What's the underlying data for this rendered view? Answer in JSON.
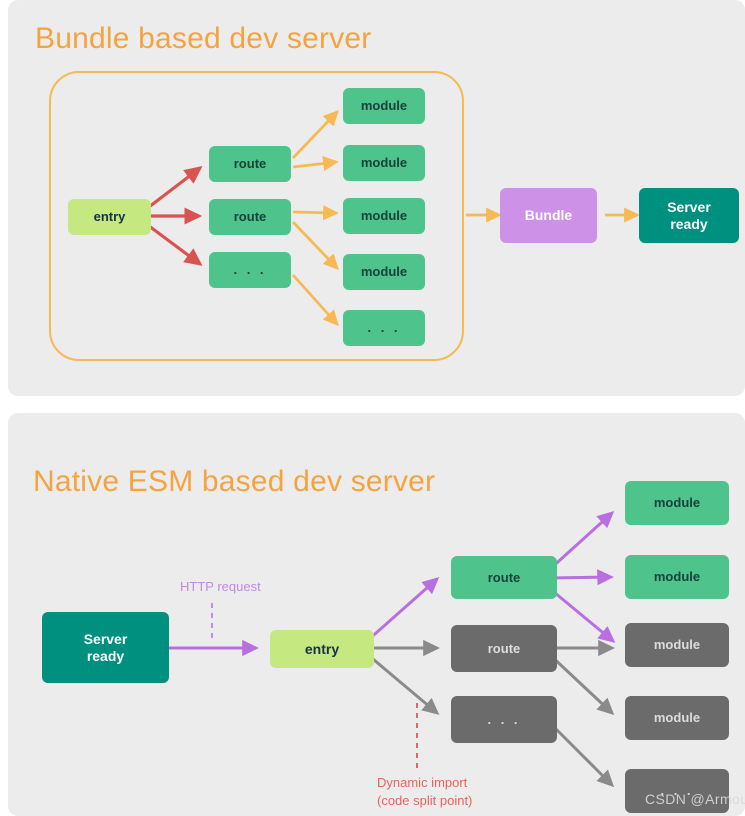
{
  "colors": {
    "background": "#ffffff",
    "panel_bg": "#ececec",
    "title_orange": "#f5a33f",
    "group_border_orange": "#f6b953",
    "entry_green": "#c5e880",
    "node_green": "#4ec48c",
    "node_gray": "#6b6b6b",
    "bundle_purple": "#cd91e8",
    "server_teal": "#00907f",
    "arrow_red": "#d9534f",
    "arrow_orange": "#f6b953",
    "arrow_purple": "#b96fe0",
    "arrow_gray": "#8a8a8a",
    "note_purple": "#c08be0",
    "note_red": "#e8645c",
    "watermark": "#d8d8d8"
  },
  "panels": [
    {
      "id": "bundle",
      "title": "Bundle based dev server",
      "nodes": {
        "entry": "entry",
        "route_1": "route",
        "route_2": "route",
        "route_3": ". . .",
        "module_1": "module",
        "module_2": "module",
        "module_3": "module",
        "module_4": "module",
        "module_5": ". . .",
        "bundle": "Bundle",
        "server_ready": "Server\nready"
      }
    },
    {
      "id": "esm",
      "title": "Native ESM based dev server",
      "nodes": {
        "server_ready": "Server\nready",
        "entry": "entry",
        "route_1": "route",
        "route_2": "route",
        "route_3": ". . .",
        "module_1": "module",
        "module_2": "module",
        "module_3": "module",
        "module_4": "module",
        "module_5": ". . ."
      },
      "annotations": {
        "http_request": "HTTP request",
        "dynamic_import": "Dynamic import\n(code split point)"
      }
    }
  ],
  "watermark": "CSDN @Armouy"
}
